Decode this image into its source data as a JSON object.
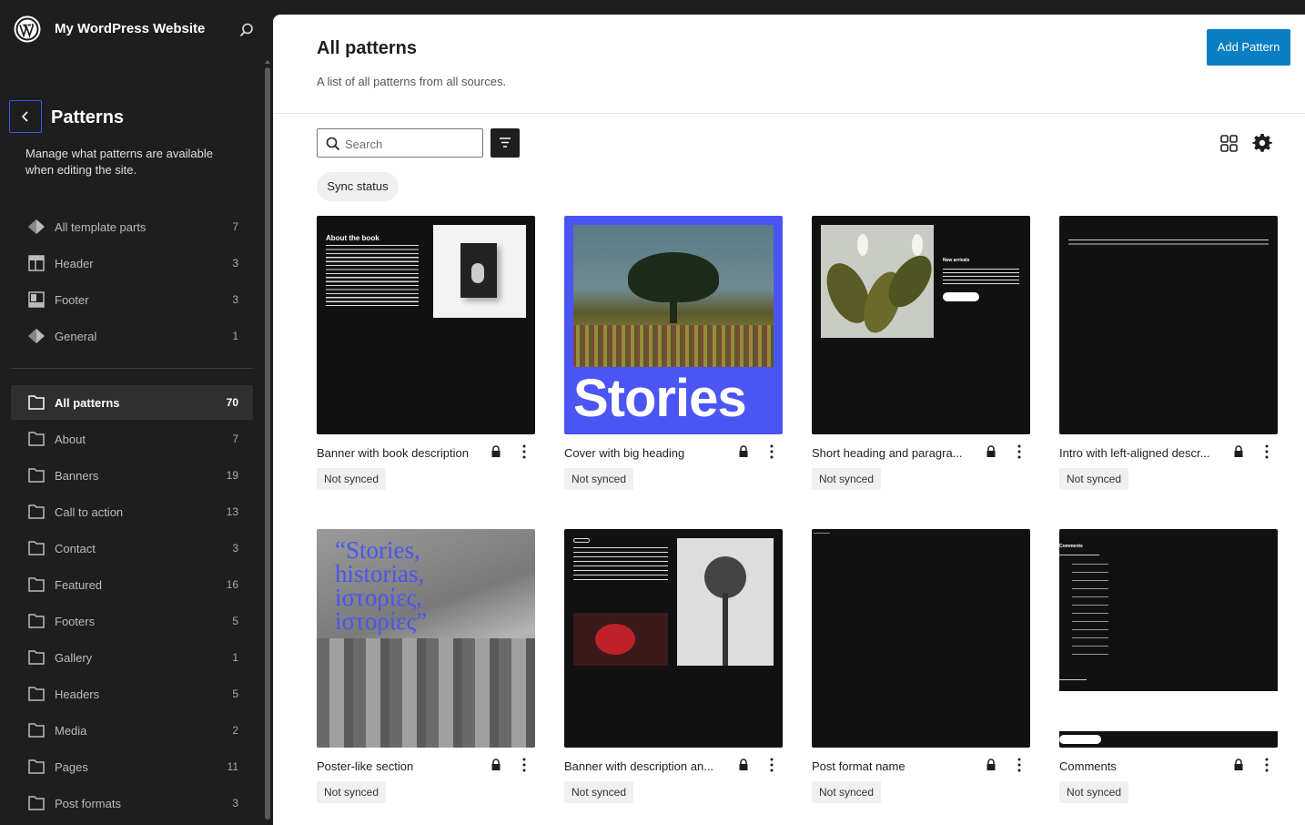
{
  "site": {
    "title": "My WordPress Website"
  },
  "sidebar": {
    "title": "Patterns",
    "description": "Manage what patterns are available when editing the site.",
    "template_parts": [
      {
        "label": "All template parts",
        "count": "7",
        "icon": "diamond-icon"
      },
      {
        "label": "Header",
        "count": "3",
        "icon": "header-icon"
      },
      {
        "label": "Footer",
        "count": "3",
        "icon": "footer-icon"
      },
      {
        "label": "General",
        "count": "1",
        "icon": "diamond-icon"
      }
    ],
    "categories": [
      {
        "label": "All patterns",
        "count": "70",
        "active": true
      },
      {
        "label": "About",
        "count": "7"
      },
      {
        "label": "Banners",
        "count": "19"
      },
      {
        "label": "Call to action",
        "count": "13"
      },
      {
        "label": "Contact",
        "count": "3"
      },
      {
        "label": "Featured",
        "count": "16"
      },
      {
        "label": "Footers",
        "count": "5"
      },
      {
        "label": "Gallery",
        "count": "1"
      },
      {
        "label": "Headers",
        "count": "5"
      },
      {
        "label": "Media",
        "count": "2"
      },
      {
        "label": "Pages",
        "count": "11"
      },
      {
        "label": "Post formats",
        "count": "3"
      }
    ]
  },
  "main": {
    "title": "All patterns",
    "subtitle": "A list of all patterns from all sources.",
    "add_button": "Add Pattern",
    "search_placeholder": "Search",
    "sync_filter": "Sync status",
    "patterns": [
      {
        "title": "Banner with book description",
        "status": "Not synced",
        "preview_heading": "About the book"
      },
      {
        "title": "Cover with big heading",
        "status": "Not synced",
        "preview_heading": "Stories"
      },
      {
        "title": "Short heading and paragra...",
        "status": "Not synced",
        "preview_heading": "New arrivals"
      },
      {
        "title": "Intro with left-aligned descr...",
        "status": "Not synced"
      },
      {
        "title": "Poster-like section",
        "status": "Not synced",
        "preview_heading": "“Stories, historias, iστορίες, iστορίες”"
      },
      {
        "title": "Banner with description an...",
        "status": "Not synced"
      },
      {
        "title": "Post format name",
        "status": "Not synced"
      },
      {
        "title": "Comments",
        "status": "Not synced",
        "preview_heading": "Comments"
      }
    ]
  },
  "colors": {
    "accent": "#3858e9",
    "button": "#0a7ec2",
    "sidebar_bg": "#1e1e1e"
  }
}
